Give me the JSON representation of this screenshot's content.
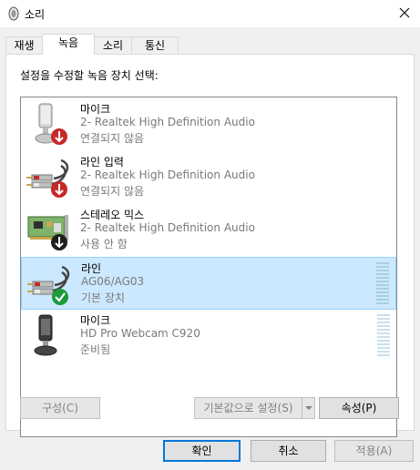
{
  "window": {
    "title": "소리"
  },
  "tabs": [
    {
      "label": "재생"
    },
    {
      "label": "녹음"
    },
    {
      "label": "소리"
    },
    {
      "label": "통신"
    }
  ],
  "panel": {
    "instruction": "설정을 수정할 녹음 장치 선택:"
  },
  "devices": [
    {
      "name": "마이크",
      "description": "2- Realtek High Definition Audio",
      "status": "연결되지 않음",
      "icon": "microphone-icon",
      "badge": "red-down-arrow"
    },
    {
      "name": "라인 입력",
      "description": "2- Realtek High Definition Audio",
      "status": "연결되지 않음",
      "icon": "rca-cable-icon",
      "badge": "red-down-arrow"
    },
    {
      "name": "스테레오 믹스",
      "description": "2- Realtek High Definition Audio",
      "status": "사용 안 함",
      "icon": "sound-card-icon",
      "badge": "black-down-arrow"
    },
    {
      "name": "라인",
      "description": "AG06/AG03",
      "status": "기본 장치",
      "icon": "rca-cable-icon",
      "badge": "green-check"
    },
    {
      "name": "마이크",
      "description": "HD Pro Webcam C920",
      "status": "준비됨",
      "icon": "webcam-microphone-icon",
      "badge": ""
    }
  ],
  "panel_buttons": {
    "configure": "구성(C)",
    "set_default": "기본값으로 설정(S)",
    "properties": "속성(P)"
  },
  "dialog_buttons": {
    "ok": "확인",
    "cancel": "취소",
    "apply": "적용(A)"
  },
  "colors": {
    "selection": "#cce8ff",
    "accent": "#0078d7"
  }
}
